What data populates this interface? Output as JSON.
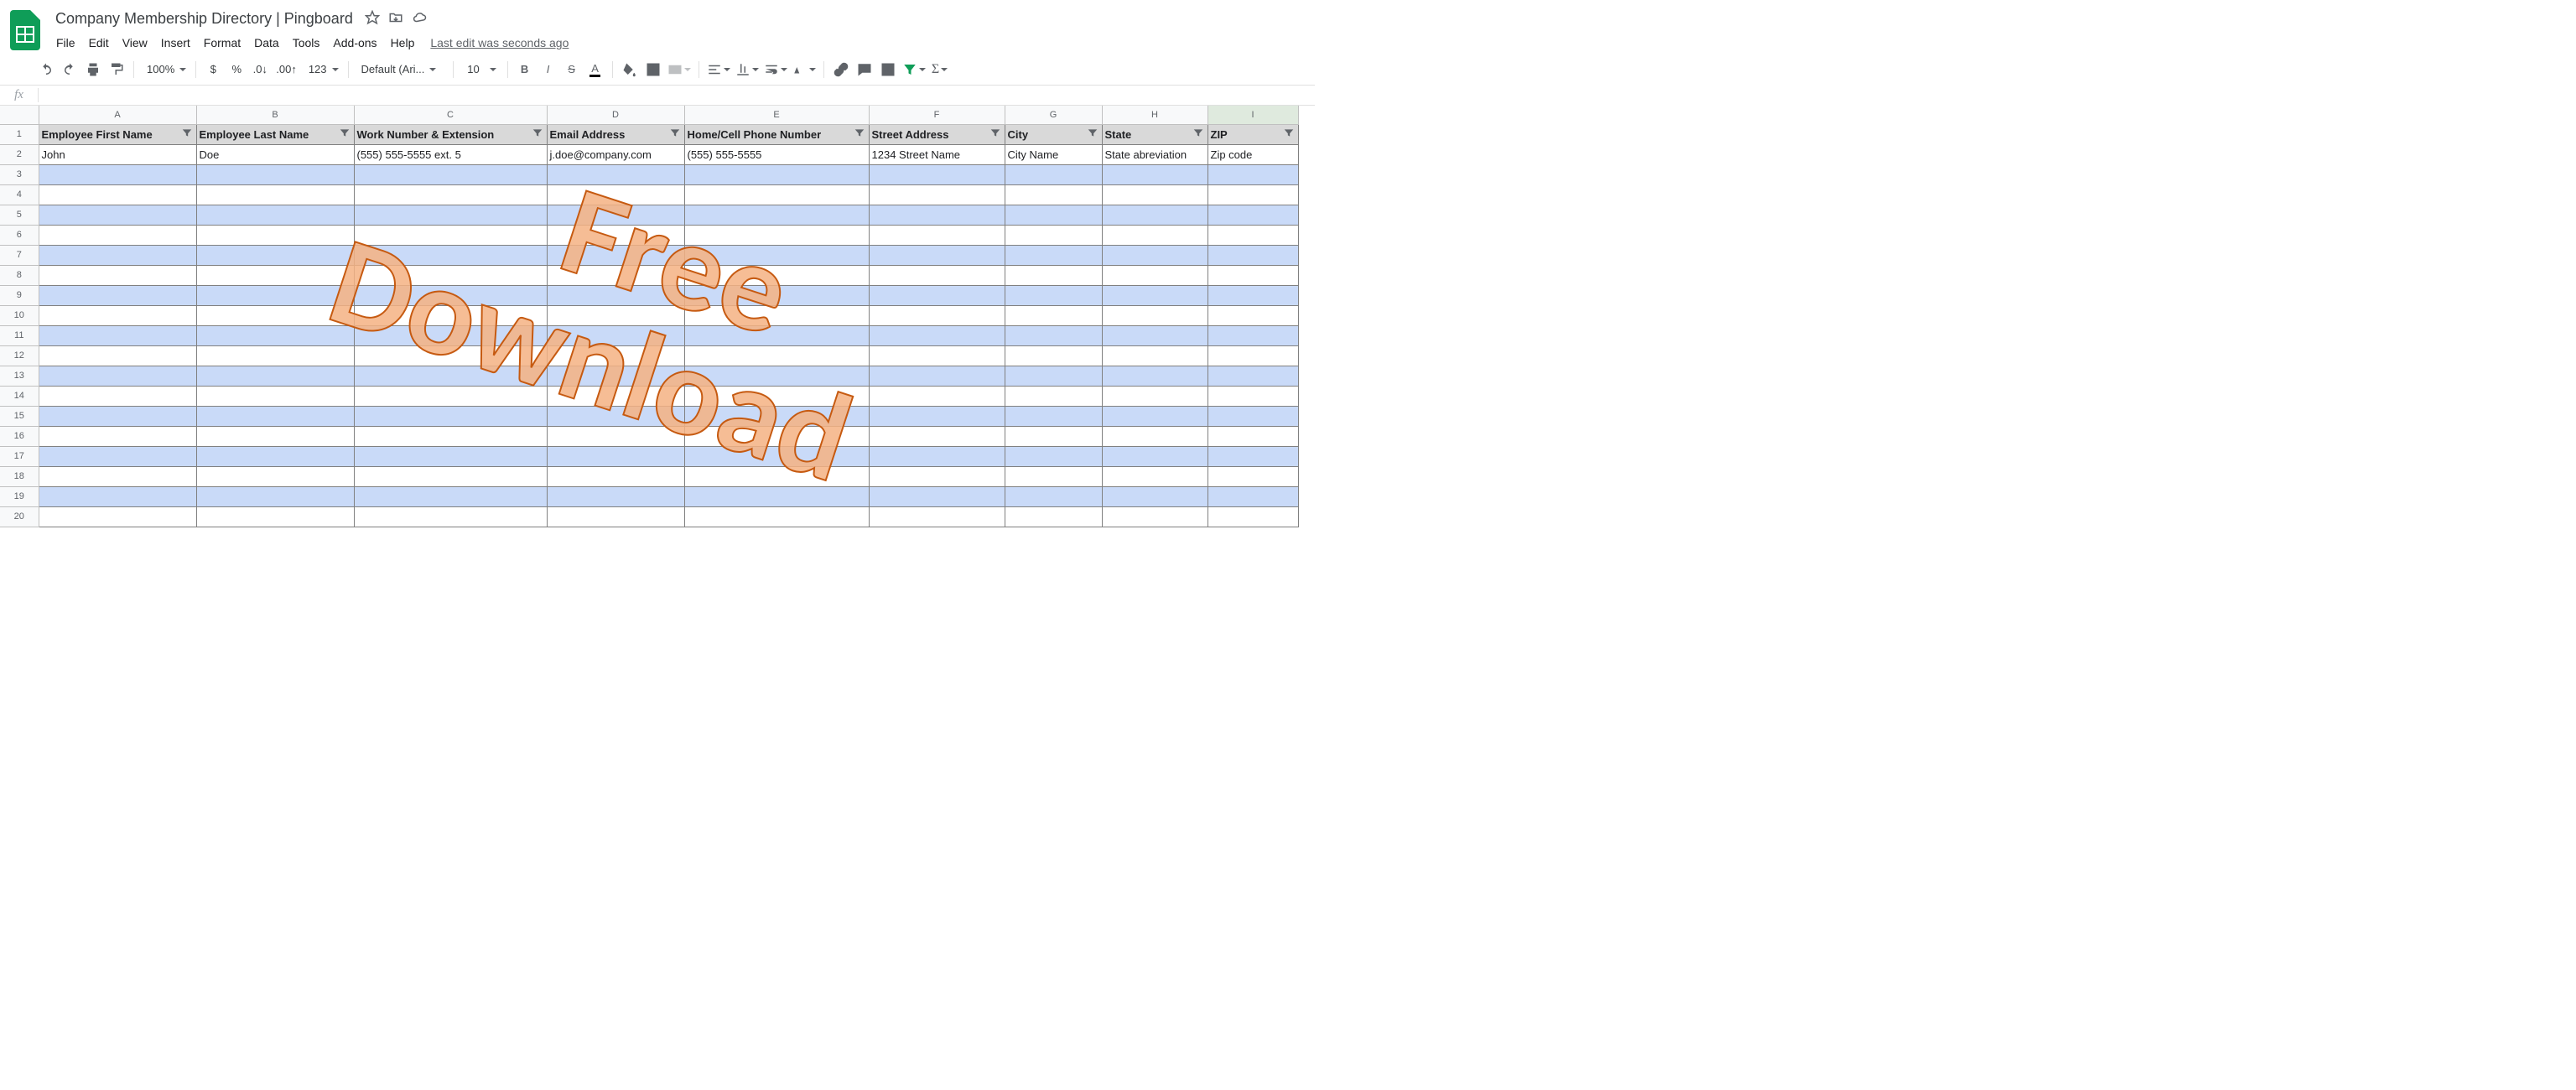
{
  "doc": {
    "title": "Company Membership Directory | Pingboard",
    "last_edit": "Last edit was seconds ago"
  },
  "menu": {
    "file": "File",
    "edit": "Edit",
    "view": "View",
    "insert": "Insert",
    "format": "Format",
    "data": "Data",
    "tools": "Tools",
    "addons": "Add-ons",
    "help": "Help"
  },
  "toolbar": {
    "zoom": "100%",
    "font": "Default (Ari...",
    "font_size": "10",
    "number_format": "123"
  },
  "columns": {
    "letters": [
      "A",
      "B",
      "C",
      "D",
      "E",
      "F",
      "G",
      "H",
      "I"
    ],
    "widths": [
      188,
      188,
      230,
      164,
      220,
      162,
      116,
      126,
      108
    ],
    "headers": [
      "Employee First Name",
      "Employee Last Name",
      "Work Number & Extension",
      "Email Address",
      "Home/Cell Phone Number",
      "Street Address",
      "City",
      "State",
      "ZIP"
    ]
  },
  "rows": {
    "count": 20,
    "data": [
      [
        "John",
        "Doe",
        "(555) 555-5555 ext. 5",
        "j.doe@company.com",
        "(555) 555-5555",
        "1234 Street Name",
        "City Name",
        "State abreviation",
        "Zip code"
      ]
    ]
  },
  "watermark": {
    "line1": "Free",
    "line2": "Download"
  }
}
